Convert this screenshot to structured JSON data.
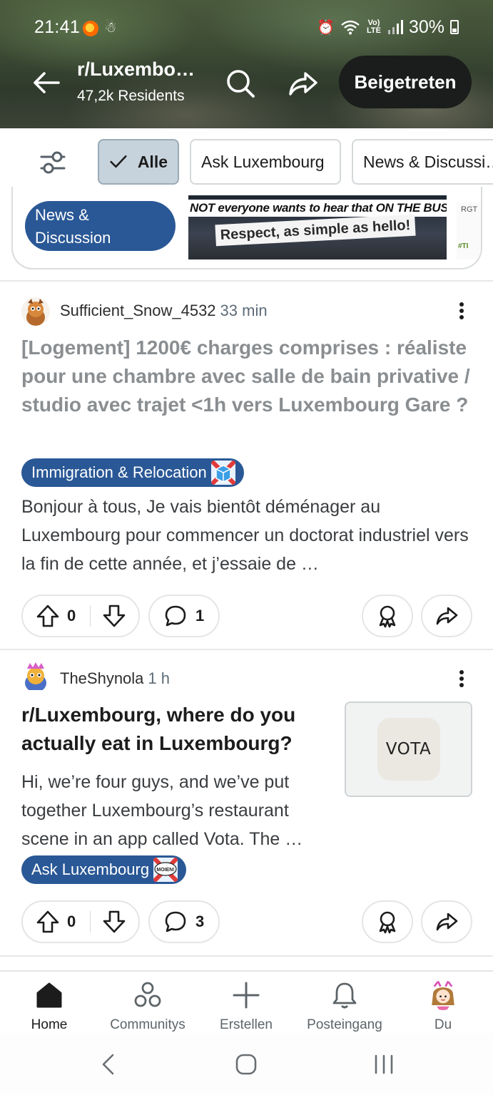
{
  "status_bar": {
    "time": "21:41",
    "network": "Vo) LTE",
    "battery": "30%",
    "icons": [
      "app-notification-icon",
      "accessibility-icon",
      "alarm-icon",
      "wifi-icon",
      "signal-icon",
      "battery-icon"
    ]
  },
  "header": {
    "subreddit": "r/Luxembo…",
    "members": "47,2k Residents",
    "joined_label": "Beigetreten"
  },
  "filters": {
    "chips": [
      {
        "label": "Alle",
        "active": true
      },
      {
        "label": "Ask Luxembourg",
        "active": false
      },
      {
        "label": "News & Discussi…",
        "active": false
      }
    ]
  },
  "pinned": {
    "flair": "News & Discussion",
    "image_line1": "NOT everyone wants to hear that ON THE BUS!",
    "image_line2": "Respect, as simple as hello!",
    "side_text": "RGT",
    "side_text2": "#TI"
  },
  "posts": [
    {
      "author": "Sufficient_Snow_4532",
      "time": "33 min",
      "title": "[Logement] 1200€ charges comprises : réaliste pour une chambre avec salle de bain privative / studio avec trajet <1h vers Luxembourg Gare ?",
      "flair": "Immigration & Relocation",
      "body": "Bonjour à tous, Je vais bientôt déménager au Luxembourg pour commencer un doctorat industriel vers la fin de cette année, et j’essaie de …",
      "votes": "0",
      "comments": "1"
    },
    {
      "author": "TheShynola",
      "time": "1 h",
      "title": "r/Luxembourg, where do you actually eat in Luxembourg?",
      "flair": "Ask Luxembourg",
      "flair_emoji_text": "MOIEN!",
      "body": "Hi, we’re four guys, and we’ve put together Luxembourg’s restaurant scene in an app called Vota. The …",
      "thumbnail_text": "VOTA",
      "votes": "0",
      "comments": "3"
    }
  ],
  "bottom_nav": [
    {
      "label": "Home",
      "icon": "home-icon",
      "active": true
    },
    {
      "label": "Communitys",
      "icon": "communities-icon",
      "active": false
    },
    {
      "label": "Erstellen",
      "icon": "plus-icon",
      "active": false
    },
    {
      "label": "Posteingang",
      "icon": "bell-icon",
      "active": false
    },
    {
      "label": "Du",
      "icon": "user-avatar",
      "active": false
    }
  ],
  "colors": {
    "flair_blue": "#2a5896",
    "joined_button": "#1a1d1b",
    "active_chip": "#c7d3dc",
    "read_title": "#8a8e91"
  }
}
